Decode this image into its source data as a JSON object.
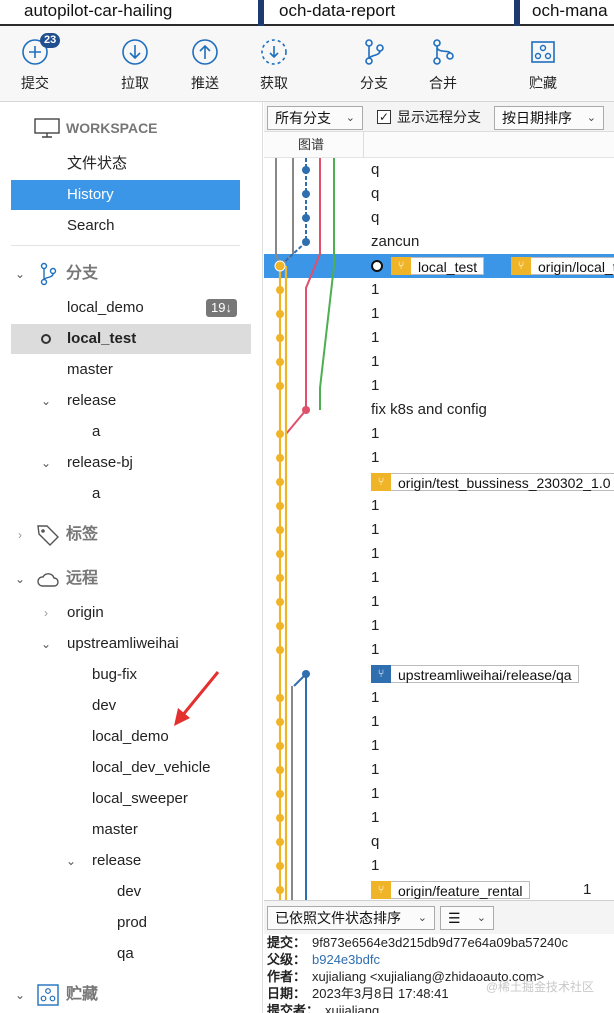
{
  "tabs": [
    "autopilot-car-hailing",
    "och-data-report",
    "och-mana"
  ],
  "toolbar": {
    "commit_badge": "23",
    "buttons": [
      "提交",
      "拉取",
      "推送",
      "获取",
      "分支",
      "合并",
      "贮藏"
    ]
  },
  "sidebar": {
    "workspace_title": "WORKSPACE",
    "workspace_items": [
      "文件状态",
      "History",
      "Search"
    ],
    "branches_title": "分支",
    "branches": {
      "local_demo": "local_demo",
      "local_demo_count": "19↓",
      "local_test": "local_test",
      "master": "master",
      "release": "release",
      "release_child": "a",
      "release_bj": "release-bj",
      "release_bj_child": "a"
    },
    "tags_title": "标签",
    "remotes_title": "远程",
    "remotes": {
      "origin": "origin",
      "upstream": "upstreamliweihai",
      "up_items": [
        "bug-fix",
        "dev",
        "local_demo",
        "local_dev_vehicle",
        "local_sweeper",
        "master",
        "release"
      ],
      "release_items": [
        "dev",
        "prod",
        "qa"
      ]
    },
    "stash_title": "贮藏"
  },
  "filter": {
    "branches_select": "所有分支",
    "show_remote_label": "显示远程分支",
    "sort_select": "按日期排序",
    "graph_col": "图谱"
  },
  "commits": [
    {
      "msg": "q"
    },
    {
      "msg": "q"
    },
    {
      "msg": "q"
    },
    {
      "msg": "zancun"
    },
    {
      "msg": "",
      "head": true,
      "tags": [
        "local_test",
        "origin/local_t"
      ]
    },
    {
      "msg": "1"
    },
    {
      "msg": "1"
    },
    {
      "msg": "1"
    },
    {
      "msg": "1"
    },
    {
      "msg": "1"
    },
    {
      "msg": "fix k8s and config"
    },
    {
      "msg": "1"
    },
    {
      "msg": "1"
    },
    {
      "msg": "",
      "tags": [
        "origin/test_bussiness_230302_1.0"
      ]
    },
    {
      "msg": "1"
    },
    {
      "msg": "1"
    },
    {
      "msg": "1"
    },
    {
      "msg": "1"
    },
    {
      "msg": "1"
    },
    {
      "msg": "1"
    },
    {
      "msg": "1"
    },
    {
      "msg": "",
      "tags": [
        "upstreamliweihai/release/qa"
      ],
      "blue": true
    },
    {
      "msg": "1"
    },
    {
      "msg": "1"
    },
    {
      "msg": "1"
    },
    {
      "msg": "1"
    },
    {
      "msg": "1"
    },
    {
      "msg": "1"
    },
    {
      "msg": "q"
    },
    {
      "msg": "1"
    },
    {
      "msg": "1",
      "tags": [
        "origin/feature_rental"
      ]
    }
  ],
  "bottom": {
    "sort_select": "已依照文件状态排序",
    "view_icon": "list-icon"
  },
  "details": {
    "commit_label": "提交：",
    "commit_value": "9f873e6564e3d215db9d77e64a09ba57240c",
    "parent_label": "父级：",
    "parent_value": "b924e3bdfc",
    "author_label": "作者：",
    "author_value": "xujialiang <xujialiang@zhidaoauto.com>",
    "date_label": "日期：",
    "date_value": "2023年3月8日 17:48:41",
    "committer_label": "提交者：",
    "committer_value": "xujialiang"
  },
  "watermark": "@稀土掘金技术社区",
  "colors": {
    "selection": "#3c96e8",
    "yellow": "#f0b429",
    "blue": "#2f6fb0",
    "red": "#e0506a",
    "green": "#4caf50",
    "gray": "#888888"
  }
}
